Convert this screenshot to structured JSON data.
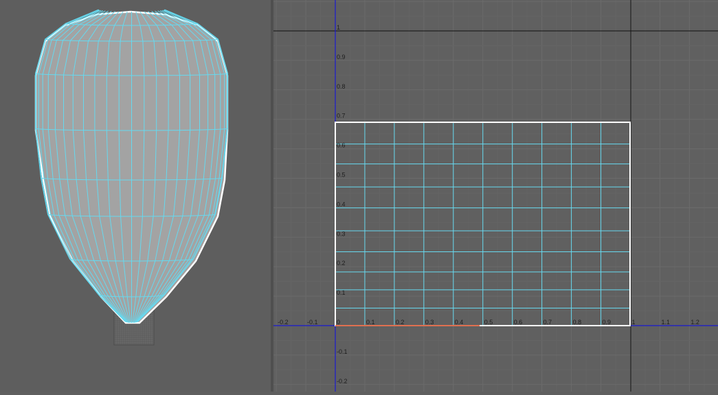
{
  "viewport_3d": {
    "object": "balloon-mesh",
    "colors": {
      "background": "#5e5e5e",
      "mesh_fill": "#a3a3a3",
      "wire": "#66d9ef",
      "outline": "#ffffff",
      "basket": "#6a6a6a"
    }
  },
  "uv_editor": {
    "u_ticks": [
      "-0.2",
      "-0.1",
      "0",
      "0.1",
      "0.2",
      "0.3",
      "0.4",
      "0.5",
      "0.6",
      "0.7",
      "0.8",
      "0.9",
      "1",
      "1.1",
      "1.2"
    ],
    "v_ticks": [
      "1",
      "0.9",
      "0.8",
      "0.7",
      "0.6",
      "0.5",
      "0.4",
      "0.3",
      "0.2",
      "0.1",
      "-0.1",
      "-0.2"
    ],
    "uv_shell": {
      "u_range": [
        0,
        1
      ],
      "v_range": [
        0,
        0.69
      ]
    },
    "colors": {
      "background": "#606060",
      "grid": "#6b6b6b",
      "axis": "#1a1ad0",
      "frame": "#111111",
      "uv_wire": "#66d9ef",
      "shell_border": "#ffffff",
      "shell_base": "#e07050"
    }
  }
}
